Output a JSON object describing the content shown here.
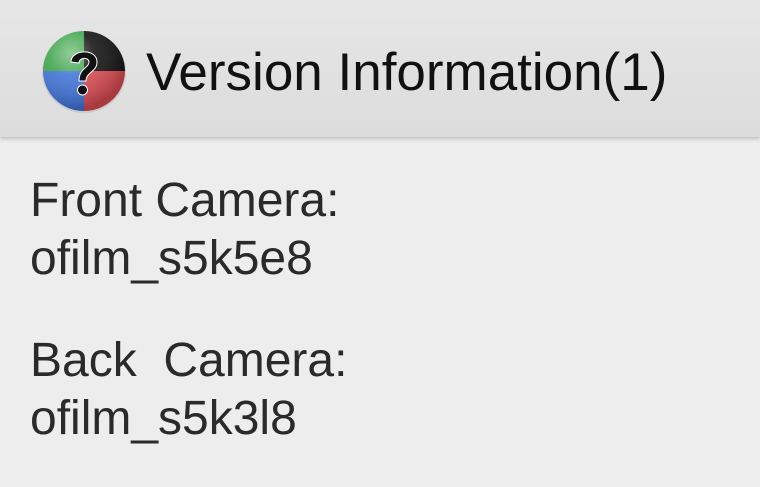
{
  "app": {
    "title": "Version Information(1)",
    "icon": "help-question-icon",
    "colors": {
      "toolbar_bg": "#e0e0e0",
      "content_bg": "#ededed",
      "text": "#2a2a2a",
      "icon_green": "#3ca44a",
      "icon_red": "#d84b52",
      "icon_blue": "#3f73d8",
      "icon_black": "#111111"
    }
  },
  "camera_info": {
    "front": {
      "label": "Front Camera:",
      "value": "ofilm_s5k5e8"
    },
    "back": {
      "label": "Back  Camera:",
      "value": "ofilm_s5k3l8"
    }
  }
}
